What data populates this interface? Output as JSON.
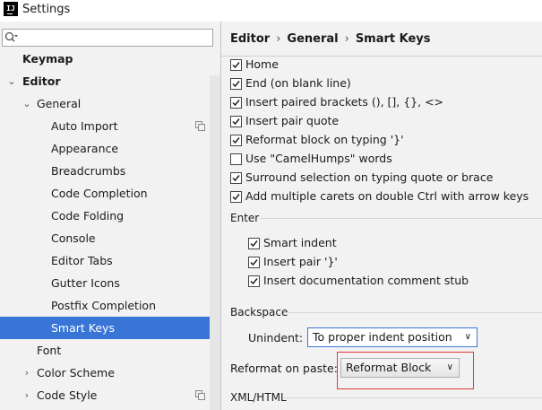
{
  "window": {
    "title": "Settings",
    "app_icon": "IJ"
  },
  "search": {
    "placeholder": "",
    "icon": "search-icon"
  },
  "tree": {
    "items": [
      {
        "label": "Keymap",
        "bold": true
      },
      {
        "label": "Editor",
        "bold": true,
        "expanded": true
      },
      {
        "label": "General",
        "expanded": true
      },
      {
        "label": "Auto Import",
        "has_copy_icon": true
      },
      {
        "label": "Appearance"
      },
      {
        "label": "Breadcrumbs"
      },
      {
        "label": "Code Completion"
      },
      {
        "label": "Code Folding"
      },
      {
        "label": "Console"
      },
      {
        "label": "Editor Tabs"
      },
      {
        "label": "Gutter Icons"
      },
      {
        "label": "Postfix Completion"
      },
      {
        "label": "Smart Keys",
        "selected": true
      },
      {
        "label": "Font"
      },
      {
        "label": "Color Scheme",
        "collapsed": true
      },
      {
        "label": "Code Style",
        "collapsed": true,
        "has_copy_icon": true
      }
    ]
  },
  "breadcrumb": {
    "items": [
      "Editor",
      "General",
      "Smart Keys"
    ],
    "separator": "›"
  },
  "options": [
    {
      "label": "Home",
      "checked": true
    },
    {
      "label": "End (on blank line)",
      "checked": true
    },
    {
      "label": "Insert paired brackets (), [], {}, <>",
      "checked": true
    },
    {
      "label": "Insert pair quote",
      "checked": true
    },
    {
      "label": "Reformat block on typing '}'",
      "checked": true
    },
    {
      "label": "Use \"CamelHumps\" words",
      "checked": false
    },
    {
      "label": "Surround selection on typing quote or brace",
      "checked": true
    },
    {
      "label": "Add multiple carets on double Ctrl with arrow keys",
      "checked": true
    }
  ],
  "enter": {
    "label": "Enter",
    "options": [
      {
        "label": "Smart indent",
        "checked": true
      },
      {
        "label": "Insert pair '}'",
        "checked": true
      },
      {
        "label": "Insert documentation comment stub",
        "checked": true
      }
    ]
  },
  "backspace": {
    "label": "Backspace",
    "unindent_label": "Unindent:",
    "unindent_value": "To proper indent position"
  },
  "reformat_on_paste": {
    "label": "Reformat on paste:",
    "value": "Reformat Block"
  },
  "xml_html": {
    "label": "XML/HTML"
  },
  "colors": {
    "selection": "#3875d7",
    "highlight_border": "#e03a3a",
    "combo_focus": "#3c78d8"
  }
}
